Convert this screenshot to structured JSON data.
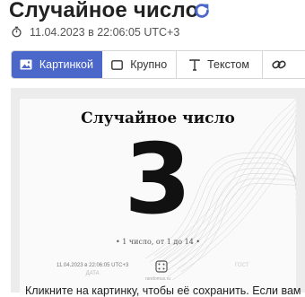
{
  "page": {
    "title": "Случайное число",
    "refresh_icon": "refresh-icon",
    "datetime": "11.04.2023 в 22:06:05 UTC+3",
    "clock_icon": "stopwatch-icon",
    "accent_color": "#4a67c9"
  },
  "tabs": [
    {
      "label": "Картинкой",
      "icon": "image-icon",
      "active": true
    },
    {
      "label": "Крупно",
      "icon": "rectangle-icon",
      "active": false
    },
    {
      "label": "Текстом",
      "icon": "text-icon",
      "active": false
    },
    {
      "label": "",
      "icon": "link-icon",
      "active": false
    }
  ],
  "card": {
    "title": "Случайное число",
    "number": "3",
    "caption": "• 1 число, от 1 до 14 •",
    "footer_datetime": "11.04.2023 в 22:06:05 UTC+3",
    "footer_sub": "ДАТА",
    "footer_domain": "randomus.ru",
    "footer_right": "ГОСТ"
  },
  "footer_text": "Кликните на картинку, чтобы её сохранить. Если вам"
}
